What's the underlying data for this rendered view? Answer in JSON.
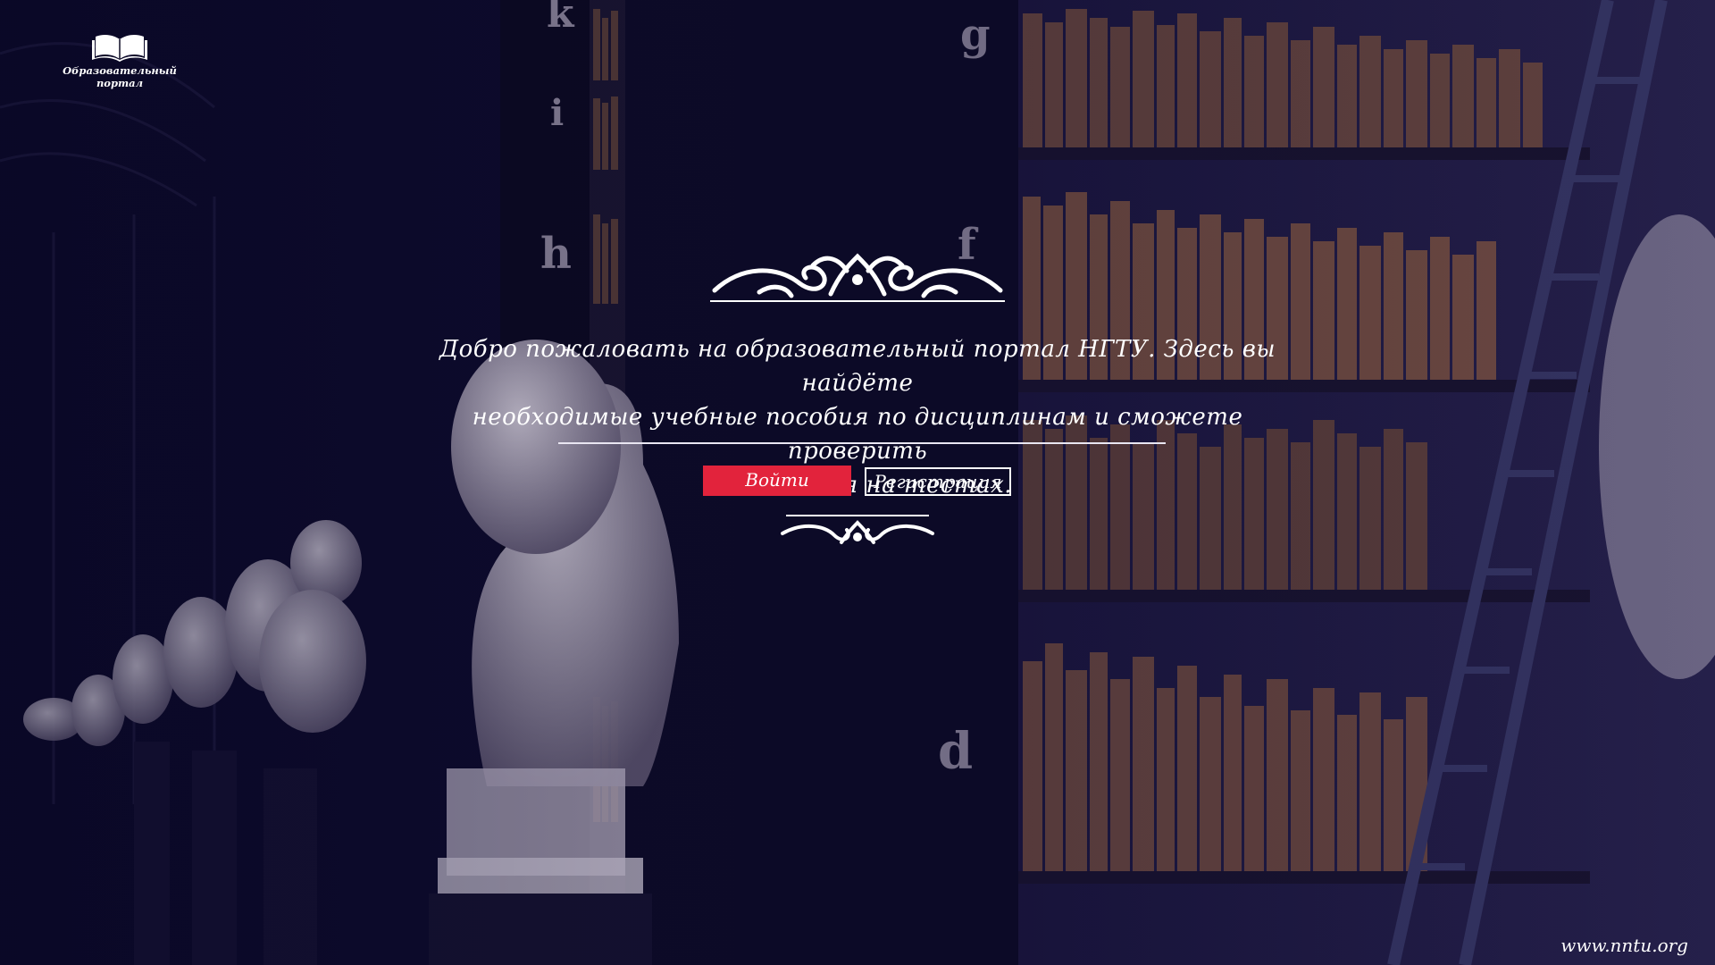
{
  "logo": {
    "icon": "open-book-icon",
    "line1": "Образовательный",
    "line2": "портал"
  },
  "welcome": {
    "line1": "Добро пожаловать на образовательный портал НГТУ. Здесь вы найдёте",
    "line2": "необходимые учебные пособия по дисциплинам и сможете проверить",
    "line3": "свои знания на тестах."
  },
  "actions": {
    "login_label": "Войти",
    "register_label": "Регистрация"
  },
  "background": {
    "shelf_letters": [
      "k",
      "i",
      "h",
      "g",
      "f",
      "d"
    ]
  },
  "footer": {
    "url": "www.nntu.org"
  },
  "colors": {
    "accent": "#e2233c",
    "overlay": "#0c0a24",
    "text": "#ffffff"
  }
}
